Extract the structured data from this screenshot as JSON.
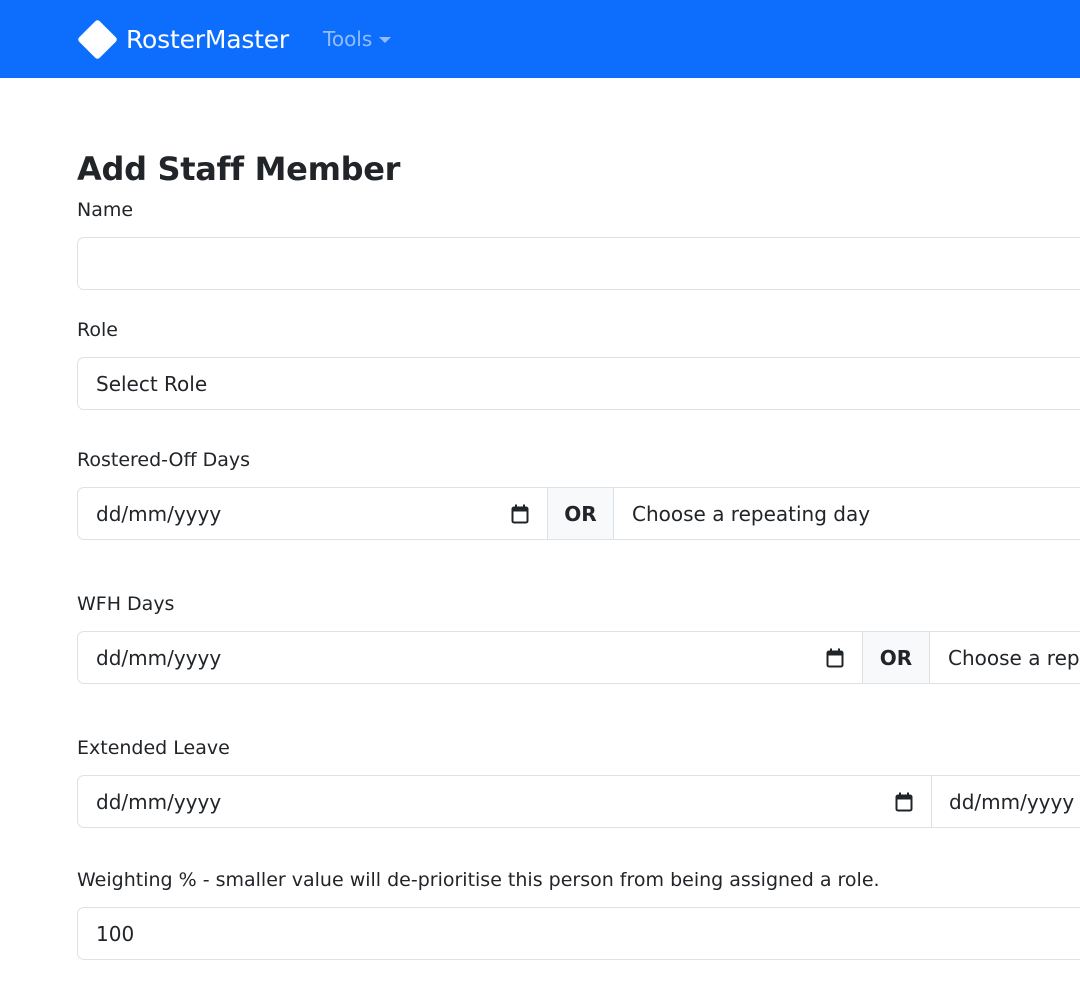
{
  "navbar": {
    "brand": "RosterMaster",
    "brand_icon": "diamond-logo-icon",
    "tools_label": "Tools",
    "tools_icon": "caret-down-icon",
    "bg_color": "#0d6efd"
  },
  "page": {
    "title": "Add Staff Member"
  },
  "form": {
    "name": {
      "label": "Name",
      "value": ""
    },
    "role": {
      "label": "Role",
      "selected": "Select Role"
    },
    "rostered_off": {
      "label": "Rostered-Off Days",
      "date_placeholder": "dd/mm/yyyy",
      "separator": "OR",
      "repeating_placeholder": "Choose a repeating day"
    },
    "wfh": {
      "label": "WFH Days",
      "date_placeholder": "dd/mm/yyyy",
      "separator": "OR",
      "repeating_placeholder": "Choose a repeating day"
    },
    "extended_leave": {
      "label": "Extended Leave",
      "start_placeholder": "dd/mm/yyyy",
      "end_placeholder": "dd/mm/yyyy"
    },
    "weighting": {
      "label": "Weighting % - smaller value will de-prioritise this person from being assigned a role.",
      "value": "100"
    }
  }
}
